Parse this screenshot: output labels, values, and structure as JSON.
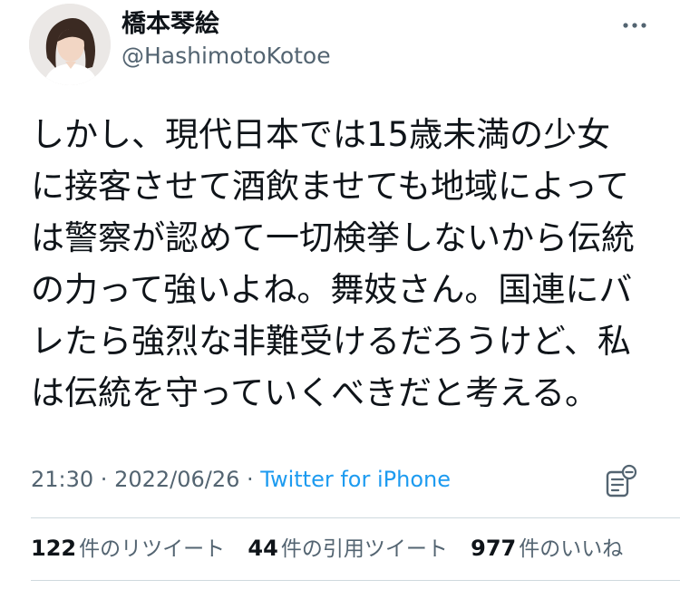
{
  "user": {
    "display_name": "橋本琴絵",
    "handle": "@HashimotoKotoe"
  },
  "tweet": {
    "lines": [
      "しかし、現代日本では15歳未満の少女",
      "に接客させて酒飲ませても地域によって",
      "は警察が認めて一切検挙しないから伝統",
      "の力って強いよね。舞妓さん。国連にバ",
      "レたら強烈な非難受けるだろうけど、私",
      "は伝統を守っていくべきだと考える。"
    ],
    "time": "21:30",
    "separator": " · ",
    "date": "2022/06/26",
    "source": "Twitter for iPhone"
  },
  "stats": {
    "retweets": {
      "count": "122",
      "label": "件のリツイート"
    },
    "quotes": {
      "count": "44",
      "label": "件の引用ツイート"
    },
    "likes": {
      "count": "977",
      "label": "件のいいね"
    }
  },
  "icons": {
    "more": "more-icon",
    "analytics": "analytics-icon"
  },
  "colors": {
    "text": "#0f1419",
    "secondary": "#536471",
    "link": "#1d9bf0",
    "divider": "#cfd9de"
  }
}
